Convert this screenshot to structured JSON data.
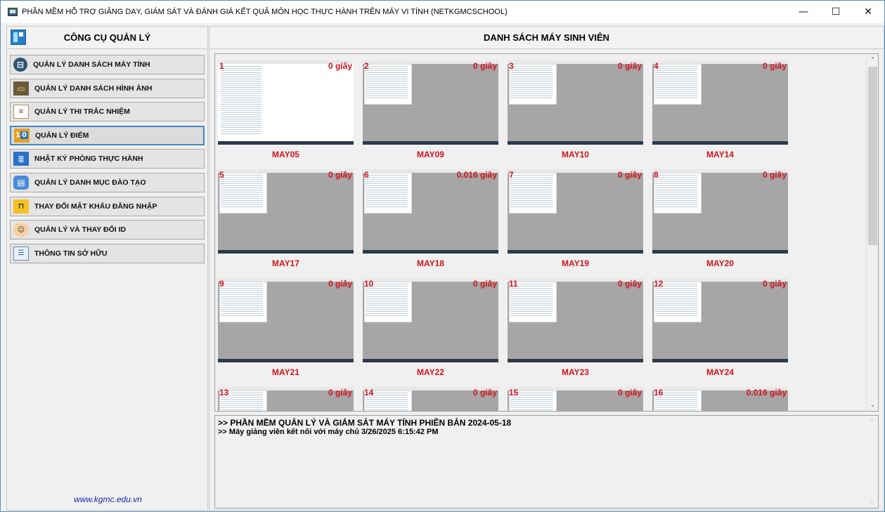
{
  "window": {
    "title": "PHẦN MỀM HỖ TRỢ GIẢNG DẠY, GIÁM SÁT VÀ ĐÁNH GIÁ KẾT QUẢ MÔN HỌC THỰC HÀNH TRÊN MÁY VI TÍNH (NETKGMCSCHOOL)",
    "minimize": "—",
    "maximize": "☐",
    "close": "✕"
  },
  "left": {
    "title": "CÔNG CỤ QUẢN LÝ",
    "menu": [
      {
        "label": "QUẢN LÝ DANH SÁCH MÁY TÍNH",
        "icon": "monitor-icon"
      },
      {
        "label": "QUẢN LÝ DANH SÁCH HÌNH ẢNH",
        "icon": "images-icon"
      },
      {
        "label": "QUẢN LÝ THI TRẮC NHIỆM",
        "icon": "quiz-icon"
      },
      {
        "label": "QUẢN LÝ ĐIỂM",
        "icon": "score-icon"
      },
      {
        "label": "NHẬT KÝ PHÒNG THỰC HÀNH",
        "icon": "journal-icon"
      },
      {
        "label": "QUẢN LÝ DANH MỤC ĐÀO TẠO",
        "icon": "catalog-icon"
      },
      {
        "label": "THAY ĐỔI MẬT KHẨU ĐĂNG NHẬP",
        "icon": "lock-icon"
      },
      {
        "label": "QUẢN LÝ VÀ THAY ĐỔI ID",
        "icon": "id-icon"
      },
      {
        "label": "THÔNG TIN SỞ HỮU",
        "icon": "info-icon"
      }
    ],
    "active_index": 3,
    "website": "www.kgmc.edu.vn"
  },
  "right": {
    "title": "DANH SÁCH MÁY SINH VIÊN",
    "machines": [
      {
        "num": "1",
        "time": "0 giây",
        "name": "MAY05"
      },
      {
        "num": "2",
        "time": "0 giây",
        "name": "MAY09"
      },
      {
        "num": "3",
        "time": "0 giây",
        "name": "MAY10"
      },
      {
        "num": "4",
        "time": "0 giây",
        "name": "MAY14"
      },
      {
        "num": "5",
        "time": "0 giây",
        "name": "MAY17"
      },
      {
        "num": "6",
        "time": "0.016 giây",
        "name": "MAY18"
      },
      {
        "num": "7",
        "time": "0 giây",
        "name": "MAY19"
      },
      {
        "num": "8",
        "time": "0 giây",
        "name": "MAY20"
      },
      {
        "num": "9",
        "time": "0 giây",
        "name": "MAY21"
      },
      {
        "num": "10",
        "time": "0 giây",
        "name": "MAY22"
      },
      {
        "num": "11",
        "time": "0 giây",
        "name": "MAY23"
      },
      {
        "num": "12",
        "time": "0 giây",
        "name": "MAY24"
      },
      {
        "num": "13",
        "time": "0 giây",
        "name": ""
      },
      {
        "num": "14",
        "time": "0 giây",
        "name": ""
      },
      {
        "num": "15",
        "time": "0 giây",
        "name": ""
      },
      {
        "num": "16",
        "time": "0.016 giây",
        "name": ""
      }
    ],
    "log": [
      ">> PHẦN MỀM QUẢN LÝ VÀ GIÁM SÁT MÁY TÍNH PHIÊN BẢN 2024-05-18",
      ">> Máy giảng viên kết nối với máy chủ 3/26/2025 6:15:42 PM"
    ]
  }
}
